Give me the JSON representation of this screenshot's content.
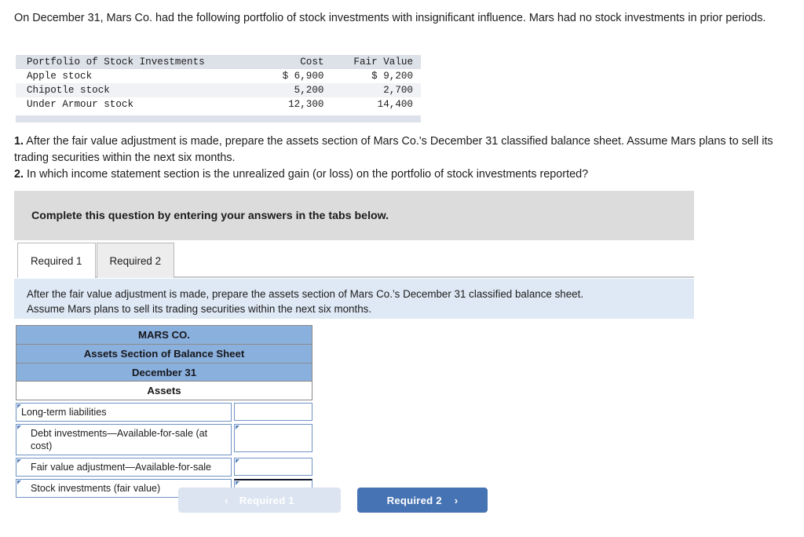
{
  "intro": {
    "text": "On December 31, Mars Co. had the following portfolio of stock investments with insignificant influence. Mars had no stock investments in prior periods."
  },
  "portfolio_table": {
    "headers": [
      "Portfolio of Stock Investments",
      "Cost",
      "Fair Value"
    ],
    "rows": [
      {
        "name": "Apple stock",
        "cost": "$ 6,900",
        "fair_value": "$ 9,200"
      },
      {
        "name": "Chipotle stock",
        "cost": "5,200",
        "fair_value": "2,700"
      },
      {
        "name": "Under Armour stock",
        "cost": "12,300",
        "fair_value": "14,400"
      }
    ]
  },
  "questions": {
    "q1_number": "1.",
    "q1_text": " After the fair value adjustment is made, prepare the assets section of Mars Co.'s December 31 classified balance sheet. Assume Mars plans to sell its trading securities within the next six months.",
    "q2_number": "2.",
    "q2_text": " In which income statement section is the unrealized gain (or loss) on the portfolio of stock investments reported?"
  },
  "banner": {
    "text": "Complete this question by entering your answers in the tabs below."
  },
  "tabs": [
    {
      "label": "Required 1",
      "active": true
    },
    {
      "label": "Required 2",
      "active": false
    }
  ],
  "info_panel": {
    "line1": "After the fair value adjustment is made, prepare the assets section of Mars Co.’s December 31 classified balance sheet.",
    "line2": "Assume Mars plans to sell its trading securities within the next six months."
  },
  "balance_sheet": {
    "title1": "MARS CO.",
    "title2": "Assets Section of Balance Sheet",
    "title3": "December 31",
    "section_header": "Assets",
    "rows": [
      {
        "label": "Long-term liabilities",
        "value": "",
        "indent": false,
        "total_line": false
      },
      {
        "label": "Debt investments—Available-for-sale (at cost)",
        "value": "",
        "indent": true,
        "total_line": false
      },
      {
        "label": "Fair value adjustment—Available-for-sale",
        "value": "",
        "indent": true,
        "total_line": false
      },
      {
        "label": "Stock investments (fair value)",
        "value": "",
        "indent": true,
        "total_line": true
      }
    ]
  },
  "nav": {
    "prev_label": "Required 1",
    "prev_chevron": "‹",
    "next_label": "Required 2",
    "next_chevron": "›"
  },
  "colors": {
    "header_blue": "#8ab0dd",
    "button_blue": "#4673b3",
    "button_disabled": "#dbe4f0",
    "info_panel_blue": "#dfe9f5",
    "banner_gray": "#dcdcdc",
    "field_border_blue": "#6f93c4"
  }
}
